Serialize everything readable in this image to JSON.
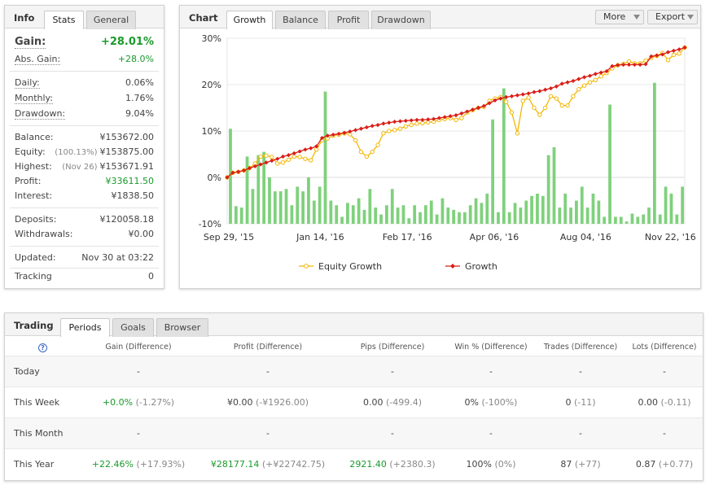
{
  "info": {
    "tabs": [
      "Info",
      "Stats",
      "General"
    ],
    "gain_label": "Gain:",
    "gain_value": "+28.01%",
    "abs_gain_label": "Abs. Gain:",
    "abs_gain_value": "+28.0%",
    "daily_label": "Daily:",
    "daily_value": "0.06%",
    "monthly_label": "Monthly:",
    "monthly_value": "1.76%",
    "drawdown_label": "Drawdown:",
    "drawdown_value": "9.04%",
    "balance_label": "Balance:",
    "balance_value": "¥153672.00",
    "equity_label": "Equity:",
    "equity_note": "(100.13%)",
    "equity_value": "¥153875.00",
    "highest_label": "Highest:",
    "highest_note": "(Nov 26)",
    "highest_value": "¥153671.91",
    "profit_label": "Profit:",
    "profit_value": "¥33611.50",
    "interest_label": "Interest:",
    "interest_value": "¥1838.50",
    "deposits_label": "Deposits:",
    "deposits_value": "¥120058.18",
    "withdrawals_label": "Withdrawals:",
    "withdrawals_value": "¥0.00",
    "updated_label": "Updated:",
    "updated_value": "Nov 30 at 03:22",
    "tracking_label": "Tracking",
    "tracking_value": "0"
  },
  "chart_panel": {
    "title": "Chart",
    "tabs": [
      "Growth",
      "Balance",
      "Profit",
      "Drawdown"
    ],
    "more_label": "More",
    "export_label": "Export"
  },
  "colors": {
    "equity": "#f2b705",
    "growth": "#d91e18",
    "bars": "#7fd17c",
    "gain_green": "#1a9a2c"
  },
  "chart_data": {
    "type": "line",
    "title": "",
    "xlabel": "",
    "ylabel": "",
    "x_ticks": [
      "Sep 29, '15",
      "Jan 14, '16",
      "Feb 17, '16",
      "Apr 06, '16",
      "Aug 04, '16",
      "Nov 22, '16"
    ],
    "y_ticks": [
      "30%",
      "20%",
      "10%",
      "0%",
      "-10%"
    ],
    "ylim": [
      -10,
      30
    ],
    "legend_position": "bottom",
    "series": [
      {
        "name": "Equity Growth",
        "type": "line",
        "values": [
          0,
          1,
          1.2,
          1.5,
          2,
          3,
          4.5,
          4.7,
          4.4,
          3,
          3.2,
          3.8,
          4.5,
          4.4,
          4,
          3.7,
          6,
          8,
          8.4,
          9,
          9.2,
          9.5,
          9.3,
          8,
          5.5,
          4.5,
          5.5,
          7,
          9.5,
          10,
          10.2,
          10.5,
          11,
          11.3,
          11.6,
          11.7,
          11.9,
          12,
          12.4,
          12.6,
          12.8,
          12.4,
          12.8,
          14,
          14.5,
          15,
          15.2,
          16.5,
          17,
          17.3,
          16.3,
          14,
          9.5,
          16.5,
          17.2,
          15,
          13.5,
          15,
          17.5,
          17,
          15.5,
          15.5,
          17.5,
          19,
          19.8,
          20.5,
          21,
          21.8,
          22.5,
          23.5,
          24.2,
          24.5,
          25,
          24.6,
          24.6,
          25.2,
          25.8,
          26.2,
          26.8,
          25.3,
          26.4,
          26.7,
          28
        ]
      },
      {
        "name": "Growth",
        "type": "line",
        "values": [
          0,
          1,
          1.2,
          1.5,
          2,
          2.4,
          2.8,
          3.2,
          3.6,
          4,
          4.5,
          4.8,
          5.2,
          5.6,
          6,
          6.3,
          6.7,
          8.5,
          9,
          9.2,
          9.4,
          9.6,
          9.9,
          10.2,
          10.5,
          10.8,
          11.1,
          11.3,
          11.6,
          11.8,
          12,
          12.1,
          12.2,
          12.3,
          12.4,
          12.4,
          12.5,
          12.6,
          12.8,
          13,
          13.2,
          13.4,
          13.8,
          14.2,
          14.6,
          15,
          15.4,
          16,
          16.6,
          17,
          17.3,
          17.5,
          17.7,
          17.9,
          18.1,
          18.4,
          18.6,
          18.9,
          19.2,
          19.6,
          20.2,
          20.5,
          20.8,
          21.2,
          21.6,
          21.9,
          22.3,
          22.6,
          22.9,
          24,
          24.2,
          24.3,
          24.3,
          24.3,
          24.3,
          24.4,
          26.1,
          26.3,
          26.5,
          27,
          27.3,
          27.6,
          28
        ]
      },
      {
        "name": "Daily",
        "type": "bar",
        "values": [
          10.5,
          -6.2,
          -6.5,
          4.5,
          -2.5,
          4.8,
          5.5,
          0,
          -3,
          -3,
          -2.5,
          -6,
          -2,
          -3,
          0,
          -5,
          -2,
          18.5,
          -5,
          -6,
          -8.5,
          -5.5,
          -6,
          -4.5,
          -7,
          -2.5,
          -6.5,
          -8,
          -6,
          -2.5,
          -6.5,
          -6,
          -8.8,
          -6,
          -7.5,
          -6,
          -5,
          -8,
          -4.5,
          -6.5,
          -7,
          -7.5,
          -7.5,
          -6,
          -4.5,
          -5.5,
          -3.5,
          12.5,
          -7.5,
          19.2,
          -7.5,
          -5.5,
          -6.5,
          -5,
          -4,
          -3.5,
          -4,
          4.8,
          6.5,
          -6.5,
          -3.5,
          -6.5,
          -5,
          -2,
          -6.5,
          -3.5,
          -5,
          -8.5,
          15.7,
          -8.5,
          -8.5,
          -9.5,
          -7.8,
          -8.5,
          -8,
          -6.5,
          20.4,
          -8,
          -2,
          -3.5,
          -8,
          -2
        ]
      }
    ]
  },
  "trading": {
    "tabs": [
      "Trading",
      "Periods",
      "Goals",
      "Browser"
    ],
    "help_icon": "?",
    "headers": [
      "Gain (Difference)",
      "Profit (Difference)",
      "Pips (Difference)",
      "Win % (Difference)",
      "Trades (Difference)",
      "Lots (Difference)"
    ],
    "rows": [
      {
        "period": "Today",
        "gain": "-",
        "gain_diff": "",
        "profit": "-",
        "profit_diff": "",
        "pips": "-",
        "pips_diff": "",
        "win": "-",
        "win_diff": "",
        "trades": "-",
        "trades_diff": "",
        "lots": "-",
        "lots_diff": ""
      },
      {
        "period": "This Week",
        "gain": "+0.0%",
        "gain_diff": "(-1.27%)",
        "profit": "¥0.00",
        "profit_diff": "(-¥1926.00)",
        "pips": "0.00",
        "pips_diff": "(-499.4)",
        "win": "0%",
        "win_diff": "(-100%)",
        "trades": "0",
        "trades_diff": "(-11)",
        "lots": "0.00",
        "lots_diff": "(-0.11)"
      },
      {
        "period": "This Month",
        "gain": "-",
        "gain_diff": "",
        "profit": "-",
        "profit_diff": "",
        "pips": "-",
        "pips_diff": "",
        "win": "-",
        "win_diff": "",
        "trades": "-",
        "trades_diff": "",
        "lots": "-",
        "lots_diff": ""
      },
      {
        "period": "This Year",
        "gain": "+22.46%",
        "gain_diff": "(+17.93%)",
        "profit": "¥28177.14",
        "profit_diff": "(+¥22742.75)",
        "pips": "2921.40",
        "pips_diff": "(+2380.3)",
        "win": "100%",
        "win_diff": "(0%)",
        "trades": "87",
        "trades_diff": "(+77)",
        "lots": "0.87",
        "lots_diff": "(+0.77)"
      }
    ]
  }
}
